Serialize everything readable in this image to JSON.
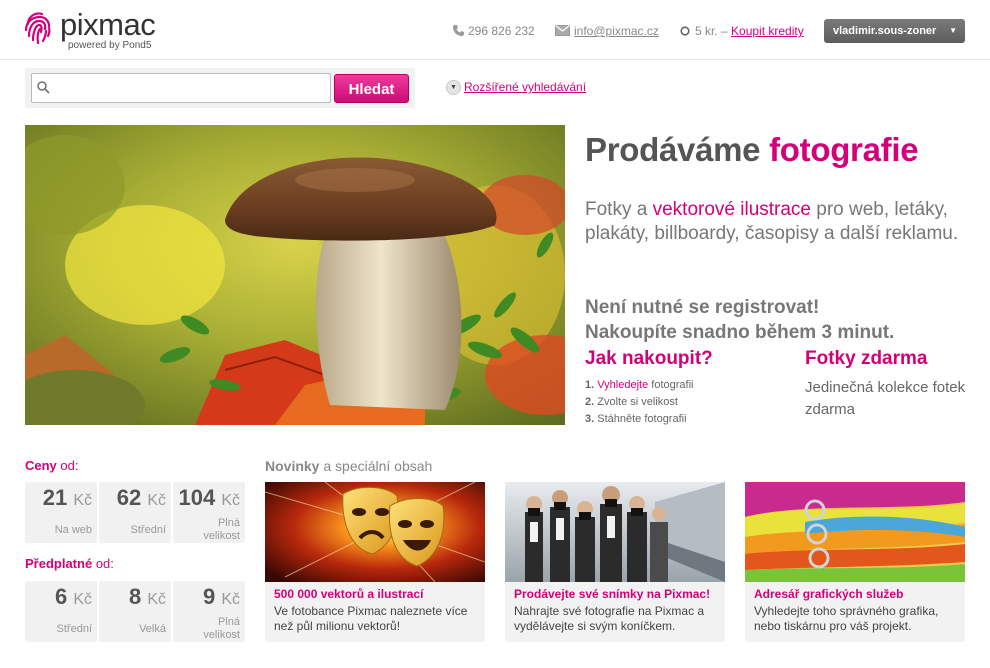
{
  "header": {
    "logo_word": "pixmac",
    "powered_by": "powered by Pond5",
    "phone": "296 826 232",
    "email": "info@pixmac.cz",
    "credits_text": "5 kr. –",
    "credits_link": "Koupit kredity",
    "user_name": "vladimir.sous-zoner",
    "brand_color": "#d4007a"
  },
  "search": {
    "placeholder": "",
    "button_label": "Hledat",
    "advanced_label": "Rozšířené vyhledávání"
  },
  "hero": {
    "title_part1": "Prodáváme",
    "title_part2": "fotografie",
    "desc_part1": "Fotky a",
    "desc_highlight": "vektorové ilustrace",
    "desc_part2": "pro web, letáky, plakáty, billboardy, časopisy a další reklamu.",
    "note_line1": "Není nutné se registrovat!",
    "note_line2": "Nakoupíte snadno během 3 minut.",
    "how_title": "Jak nakoupit?",
    "steps": [
      {
        "num": "1.",
        "link": "Vyhledejte",
        "text": "fotografii"
      },
      {
        "num": "2.",
        "link": "",
        "text": "Zvolte si velikost"
      },
      {
        "num": "3.",
        "link": "",
        "text": "Stáhněte fotografii"
      }
    ],
    "free_title": "Fotky zdarma",
    "free_desc": "Jedinečná kolekce fotek zdarma"
  },
  "prices": {
    "ceny_title": "Ceny",
    "ceny_suffix": "od:",
    "ceny": [
      {
        "value": "21",
        "currency": "Kč",
        "label": "Na web"
      },
      {
        "value": "62",
        "currency": "Kč",
        "label": "Střední"
      },
      {
        "value": "104",
        "currency": "Kč",
        "label": "Plná velikost"
      }
    ],
    "predplatne_title": "Předplatné",
    "predplatne_suffix": "od:",
    "predplatne": [
      {
        "value": "6",
        "currency": "Kč",
        "label": "Střední"
      },
      {
        "value": "8",
        "currency": "Kč",
        "label": "Velká"
      },
      {
        "value": "9",
        "currency": "Kč",
        "label": "Plná velikost"
      }
    ]
  },
  "news": {
    "title_bold": "Novinky",
    "title_rest": "a speciální obsah",
    "cards": [
      {
        "title": "500 000 vektorů a ilustrací",
        "desc": "Ve fotobance Pixmac naleznete více než půl milionu vektorů!"
      },
      {
        "title": "Prodávejte své snímky na Pixmac!",
        "desc": "Nahrajte své fotografie na Pixmac a vydělávejte si svým koníčkem."
      },
      {
        "title": "Adresář grafických služeb",
        "desc": "Vyhledejte toho správného grafika, nebo tiskárnu pro váš projekt."
      }
    ]
  }
}
